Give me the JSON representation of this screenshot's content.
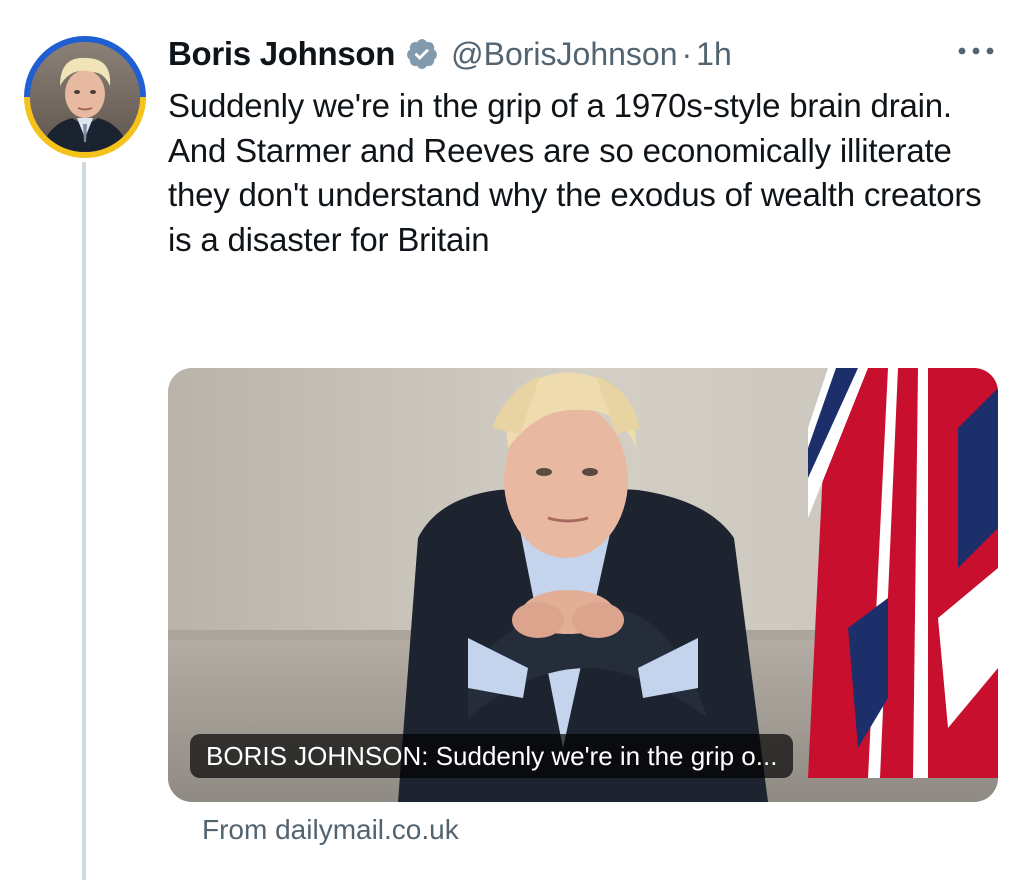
{
  "author": {
    "display_name": "Boris Johnson",
    "handle": "@BorisJohnson",
    "separator": "·",
    "timestamp": "1h",
    "verified_icon": "verified-badge-icon",
    "avatar_ring_colors": [
      "#1f5fd1",
      "#f4c21a"
    ]
  },
  "more_menu_icon": "more-dots-icon",
  "tweet": {
    "text": "Suddenly we're in the grip of a 1970s-style brain drain. And Starmer and Reeves are so economically illiterate they don't understand why the exodus of wealth creators is a disaster for Britain"
  },
  "link_card": {
    "title": "BORIS JOHNSON: Suddenly we're in the grip o...",
    "source": "From dailymail.co.uk"
  },
  "colors": {
    "text": "#0f1419",
    "secondary": "#536471",
    "thread_line": "#cfd9de",
    "verified_badge": "#829aab"
  }
}
